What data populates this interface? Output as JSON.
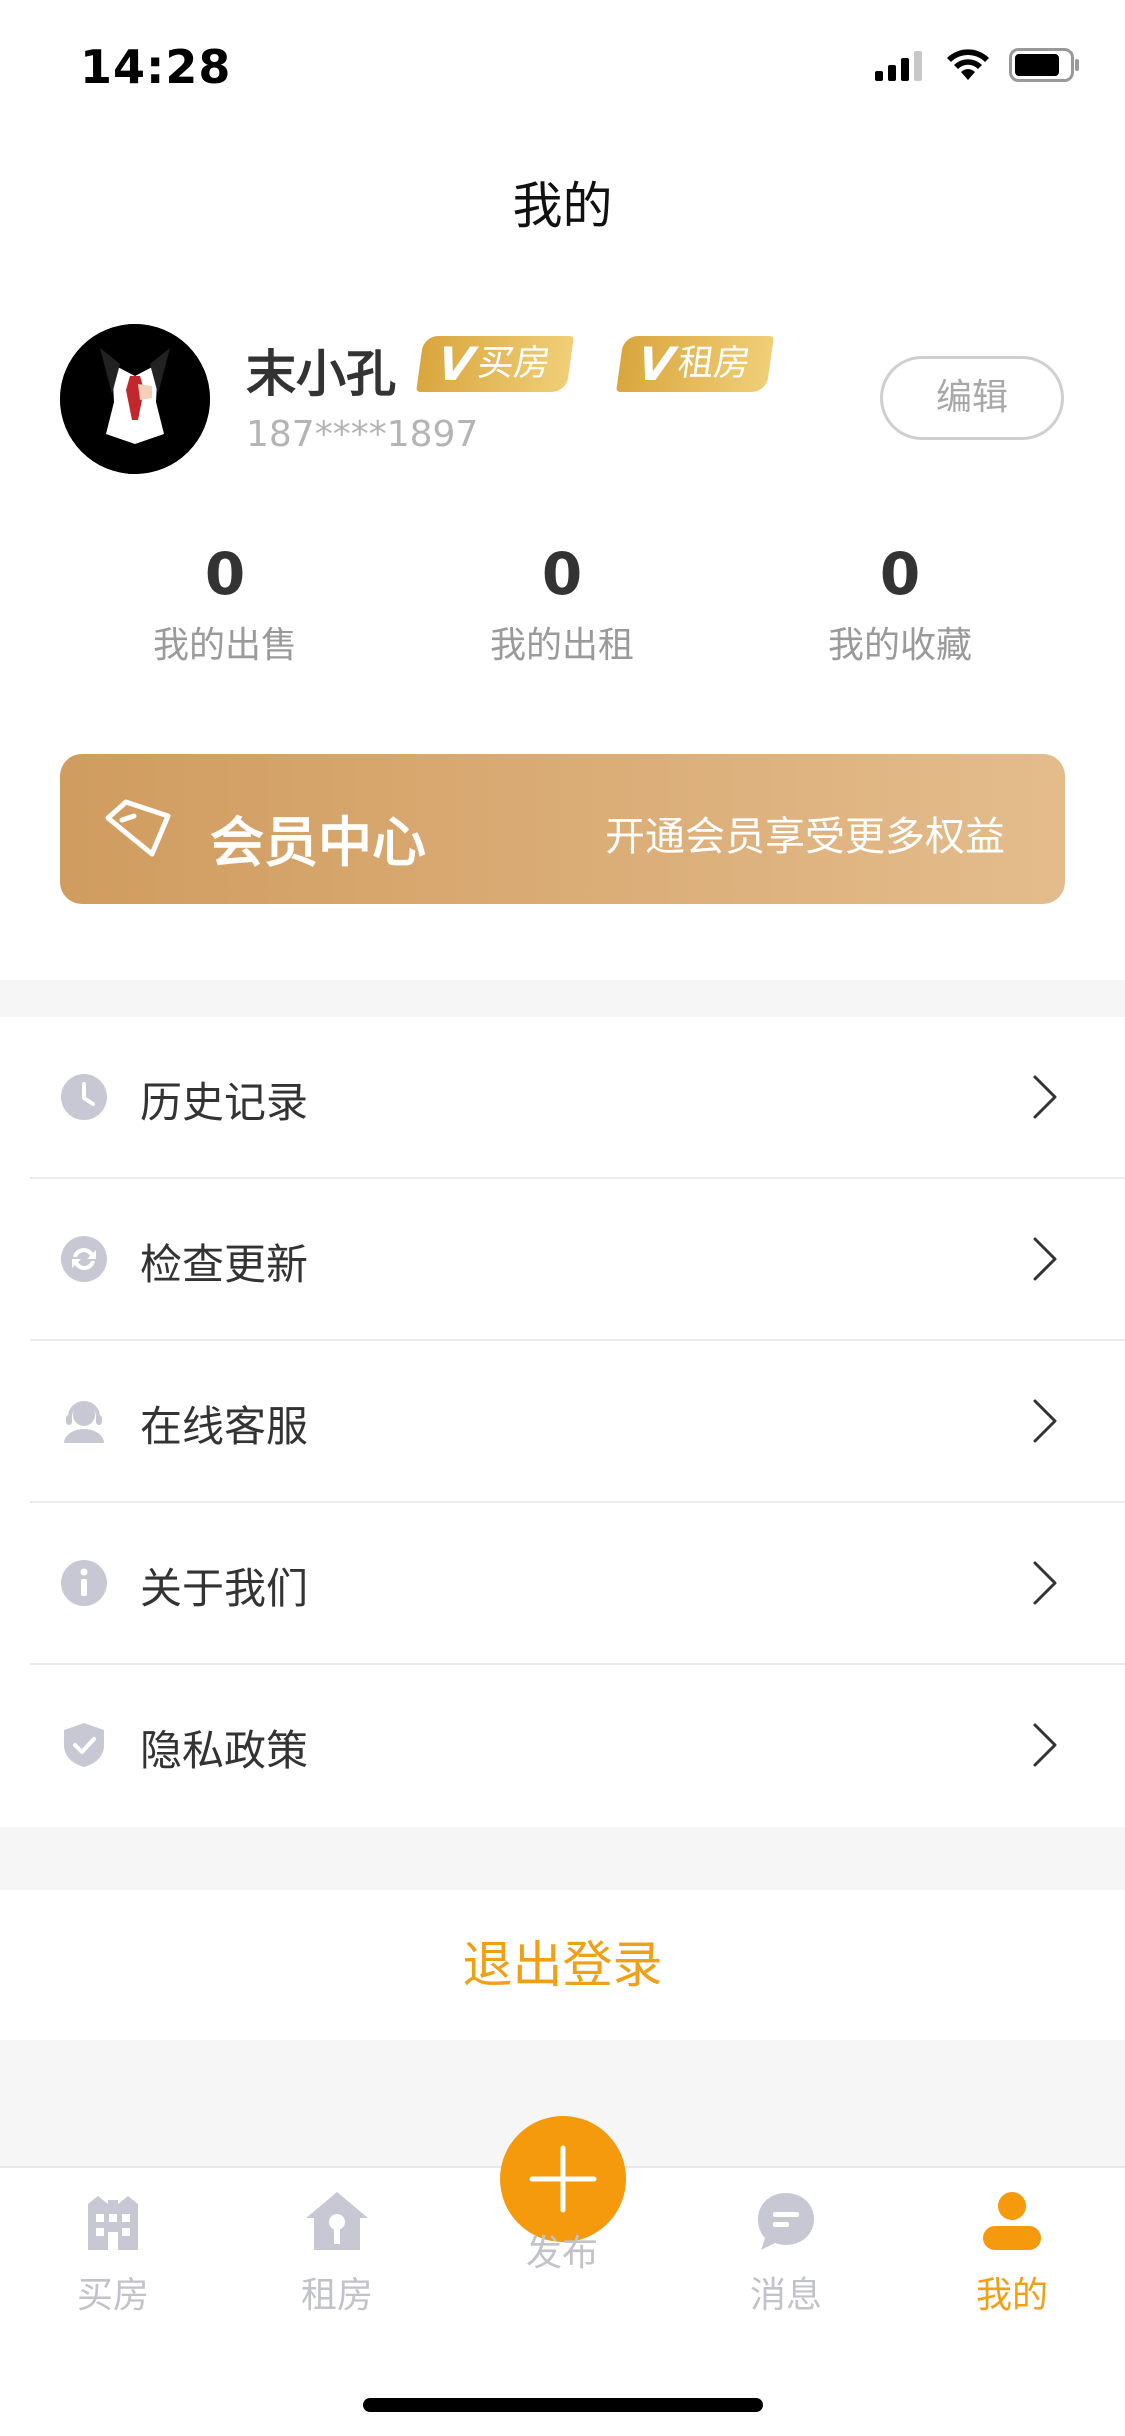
{
  "status_bar": {
    "time": "14:28"
  },
  "nav": {
    "title": "我的"
  },
  "profile": {
    "username": "末小孔",
    "badges": [
      {
        "mark": "V",
        "label": "买房"
      },
      {
        "mark": "V",
        "label": "租房"
      }
    ],
    "phone": "187****1897",
    "edit_label": "编辑"
  },
  "stats": [
    {
      "value": "0",
      "label": "我的出售"
    },
    {
      "value": "0",
      "label": "我的出租"
    },
    {
      "value": "0",
      "label": "我的收藏"
    }
  ],
  "member": {
    "title": "会员中心",
    "subtitle": "开通会员享受更多权益"
  },
  "menu": [
    {
      "label": "历史记录",
      "icon": "clock-icon"
    },
    {
      "label": "检查更新",
      "icon": "refresh-icon"
    },
    {
      "label": "在线客服",
      "icon": "customer-service-icon"
    },
    {
      "label": "关于我们",
      "icon": "info-icon"
    },
    {
      "label": "隐私政策",
      "icon": "shield-icon"
    }
  ],
  "logout": {
    "label": "退出登录"
  },
  "tabbar": [
    {
      "label": "买房",
      "icon": "building-icon",
      "active": false
    },
    {
      "label": "租房",
      "icon": "house-key-icon",
      "active": false
    },
    {
      "label": "发布",
      "icon": "plus-icon",
      "active": false
    },
    {
      "label": "消息",
      "icon": "chat-icon",
      "active": false
    },
    {
      "label": "我的",
      "icon": "person-icon",
      "active": true
    }
  ],
  "colors": {
    "accent": "#f0a017",
    "member_gradient_start": "#d09c5f",
    "member_gradient_end": "#e4bc8c",
    "icon_gray": "#c2c2ca"
  }
}
